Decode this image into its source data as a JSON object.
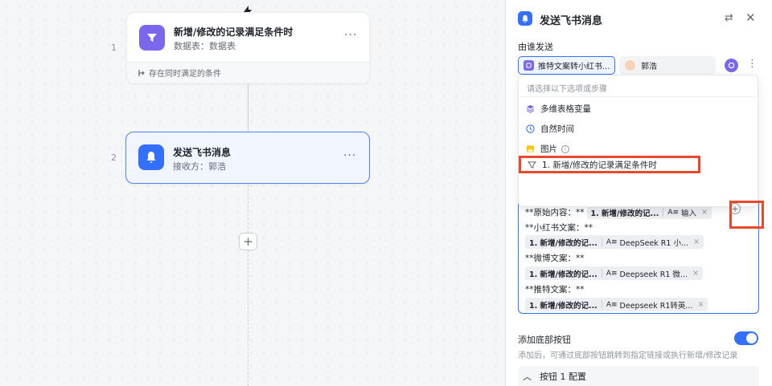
{
  "canvas": {
    "node1": {
      "step": "1",
      "title": "新增/修改的记录满足条件时",
      "subtitle": "数据表：数据表",
      "footer": "存在同时满足的条件",
      "more": "···"
    },
    "node2": {
      "step": "2",
      "title": "发送飞书消息",
      "subtitle": "接收方：郭浩",
      "more": "···"
    },
    "add_label": "+"
  },
  "panel": {
    "title": "发送飞书消息",
    "swap_icon": "⇄",
    "close_icon": "✕",
    "sender_label": "由谁发送",
    "sender_value": "推特文案转小红书...",
    "person_value": "郭浩",
    "more_icon": "⋮",
    "dropdown": {
      "hint": "请选择以下选项或步骤",
      "items": [
        {
          "label": "多维表格变量",
          "icon": "layers-icon"
        },
        {
          "label": "自然时间",
          "icon": "clock-icon"
        },
        {
          "label": "图片",
          "icon": "image-icon"
        },
        {
          "label": "1. 新增/修改的记录满足条件时",
          "icon": "filter-icon"
        }
      ],
      "info_icon": "i"
    },
    "editor": {
      "lines": [
        {
          "prefix": "**原始内容：**",
          "chip_source": "1. 新增/修改的记...",
          "chip_field": "输入"
        },
        {
          "prefix": "**小红书文案：**"
        },
        {
          "chip_source": "1. 新增/修改的记...",
          "chip_field": "DeepSeek R1 小..."
        },
        {
          "prefix": "**微博文案：**"
        },
        {
          "chip_source": "1. 新增/修改的记...",
          "chip_field": "Deepseek R1 微..."
        },
        {
          "prefix": "**推特文案：**"
        },
        {
          "chip_source": "1. 新增/修改的记...",
          "chip_field": "Deepseek R1转英..."
        }
      ],
      "chip_close": "×",
      "insert_icon": "+"
    },
    "bottom_button": {
      "label": "添加底部按钮",
      "description": "添加后，可通过底部按钮跳转到指定链接或执行新增/修改记录",
      "enabled": true
    },
    "button_config": {
      "label": "按钮 1 配置",
      "chevron": "︿"
    }
  },
  "colors": {
    "accent": "#3370ff",
    "purple": "#7b67ee",
    "highlight": "#e8482b"
  }
}
